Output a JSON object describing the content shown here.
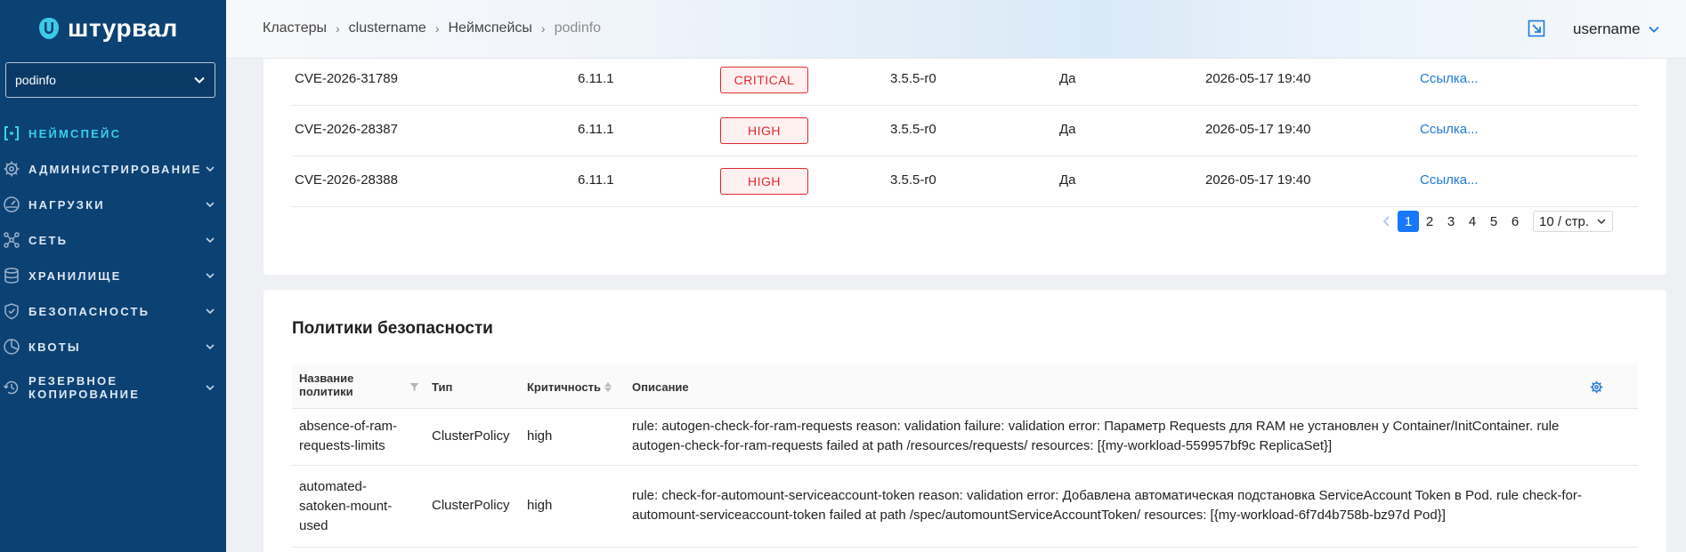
{
  "brand": {
    "name": "штурвал"
  },
  "namespace_select": {
    "value": "podinfo"
  },
  "nav": [
    {
      "label": "НЕЙМСПЕЙС",
      "icon": "namespace-icon",
      "active": true
    },
    {
      "label": "АДМИНИСТРИРОВАНИЕ",
      "icon": "gear-icon"
    },
    {
      "label": "НАГРУЗКИ",
      "icon": "gauge-icon"
    },
    {
      "label": "СЕТЬ",
      "icon": "network-icon"
    },
    {
      "label": "ХРАНИЛИЩЕ",
      "icon": "database-icon"
    },
    {
      "label": "БЕЗОПАСНОСТЬ",
      "icon": "shield-icon"
    },
    {
      "label": "КВОТЫ",
      "icon": "pie-icon"
    },
    {
      "label": "РЕЗЕРВНОЕ КОПИРОВАНИЕ",
      "icon": "backup-icon"
    }
  ],
  "breadcrumbs": [
    "Кластеры",
    "clustername",
    "Неймспейсы",
    "podinfo"
  ],
  "user": {
    "name": "username"
  },
  "vulnerabilities": [
    {
      "id": "CVE-2026-31789",
      "version": "6.11.1",
      "severity": "CRITICAL",
      "fixed": "3.5.5-r0",
      "fixable": "Да",
      "date": "2026-05-17 19:40",
      "link": "Ссылка..."
    },
    {
      "id": "CVE-2026-28387",
      "version": "6.11.1",
      "severity": "HIGH",
      "fixed": "3.5.5-r0",
      "fixable": "Да",
      "date": "2026-05-17 19:40",
      "link": "Ссылка..."
    },
    {
      "id": "CVE-2026-28388",
      "version": "6.11.1",
      "severity": "HIGH",
      "fixed": "3.5.5-r0",
      "fixable": "Да",
      "date": "2026-05-17 19:40",
      "link": "Ссылка..."
    }
  ],
  "pagination": {
    "pages": [
      "1",
      "2",
      "3",
      "4",
      "5",
      "6"
    ],
    "current": "1",
    "page_size": "10 / стр."
  },
  "policies": {
    "title": "Политики безопасности",
    "columns": {
      "name": "Название политики",
      "type": "Тип",
      "severity": "Критичность",
      "description": "Описание"
    },
    "rows": [
      {
        "name": "absence-of-ram-requests-limits",
        "type": "ClusterPolicy",
        "severity": "high",
        "description": "rule: autogen-check-for-ram-requests reason: validation failure: validation error: Параметр Requests для RAM не установлен у Container/InitContainer. rule autogen-check-for-ram-requests failed at path /resources/requests/ resources: [{my-workload-559957bf9c ReplicaSet}]"
      },
      {
        "name": "automated-satoken-mount-used",
        "type": "ClusterPolicy",
        "severity": "high",
        "description": "rule: check-for-automount-serviceaccount-token reason: validation error: Добавлена автоматическая подстановка ServiceAccount Token в Pod. rule check-for-automount-serviceaccount-token failed at path /spec/automountServiceAccountToken/ resources: [{my-workload-6f7d4b758b-bz97d Pod}]"
      }
    ]
  }
}
